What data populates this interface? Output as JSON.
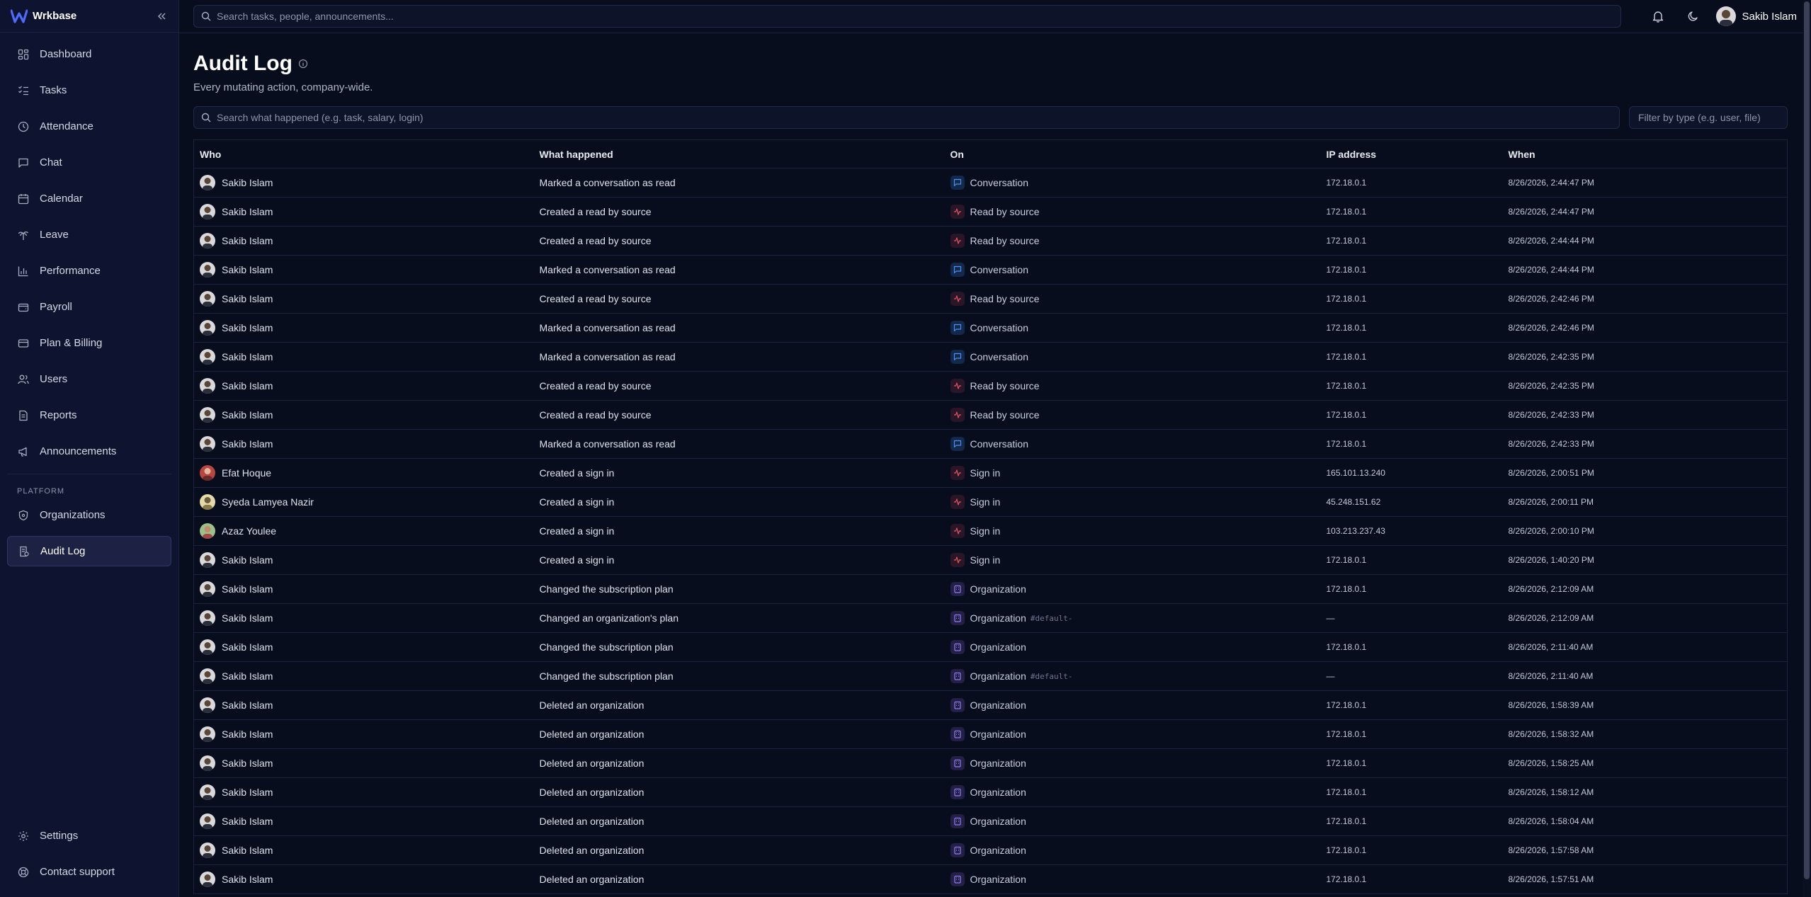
{
  "app": {
    "name": "Wrkbase"
  },
  "sidebar": {
    "items": [
      {
        "label": "Dashboard",
        "icon": "dashboard-icon"
      },
      {
        "label": "Tasks",
        "icon": "tasks-icon"
      },
      {
        "label": "Attendance",
        "icon": "clock-icon"
      },
      {
        "label": "Chat",
        "icon": "chat-icon"
      },
      {
        "label": "Calendar",
        "icon": "calendar-icon"
      },
      {
        "label": "Leave",
        "icon": "palm-tree-icon"
      },
      {
        "label": "Performance",
        "icon": "bar-chart-icon"
      },
      {
        "label": "Payroll",
        "icon": "wallet-icon"
      },
      {
        "label": "Plan & Billing",
        "icon": "credit-card-icon"
      },
      {
        "label": "Users",
        "icon": "users-icon"
      },
      {
        "label": "Reports",
        "icon": "file-icon"
      },
      {
        "label": "Announcements",
        "icon": "megaphone-icon"
      }
    ],
    "platform_label": "PLATFORM",
    "platform_items": [
      {
        "label": "Organizations",
        "icon": "shield-icon"
      },
      {
        "label": "Audit Log",
        "icon": "audit-log-icon",
        "active": true
      }
    ],
    "bottom_items": [
      {
        "label": "Settings",
        "icon": "gear-icon"
      },
      {
        "label": "Contact support",
        "icon": "lifebuoy-icon"
      }
    ]
  },
  "topbar": {
    "search_placeholder": "Search tasks, people, announcements...",
    "user_name": "Sakib Islam"
  },
  "page": {
    "title": "Audit Log",
    "subtitle": "Every mutating action, company-wide.",
    "search_placeholder": "Search what happened (e.g. task, salary, login)",
    "type_filter_placeholder": "Filter by type (e.g. user, file)"
  },
  "table": {
    "columns": [
      "Who",
      "What happened",
      "On",
      "IP address",
      "When"
    ],
    "rows": [
      {
        "who": "Sakib Islam",
        "avatar": "sakib",
        "what": "Marked a conversation as read",
        "on": "Conversation",
        "on_type": "conv",
        "ref": "",
        "ip": "172.18.0.1",
        "when": "8/26/2026, 2:44:47 PM"
      },
      {
        "who": "Sakib Islam",
        "avatar": "sakib",
        "what": "Created a read by source",
        "on": "Read by source",
        "on_type": "read",
        "ref": "",
        "ip": "172.18.0.1",
        "when": "8/26/2026, 2:44:47 PM"
      },
      {
        "who": "Sakib Islam",
        "avatar": "sakib",
        "what": "Created a read by source",
        "on": "Read by source",
        "on_type": "read",
        "ref": "",
        "ip": "172.18.0.1",
        "when": "8/26/2026, 2:44:44 PM"
      },
      {
        "who": "Sakib Islam",
        "avatar": "sakib",
        "what": "Marked a conversation as read",
        "on": "Conversation",
        "on_type": "conv",
        "ref": "",
        "ip": "172.18.0.1",
        "when": "8/26/2026, 2:44:44 PM"
      },
      {
        "who": "Sakib Islam",
        "avatar": "sakib",
        "what": "Created a read by source",
        "on": "Read by source",
        "on_type": "read",
        "ref": "",
        "ip": "172.18.0.1",
        "when": "8/26/2026, 2:42:46 PM"
      },
      {
        "who": "Sakib Islam",
        "avatar": "sakib",
        "what": "Marked a conversation as read",
        "on": "Conversation",
        "on_type": "conv",
        "ref": "",
        "ip": "172.18.0.1",
        "when": "8/26/2026, 2:42:46 PM"
      },
      {
        "who": "Sakib Islam",
        "avatar": "sakib",
        "what": "Marked a conversation as read",
        "on": "Conversation",
        "on_type": "conv",
        "ref": "",
        "ip": "172.18.0.1",
        "when": "8/26/2026, 2:42:35 PM"
      },
      {
        "who": "Sakib Islam",
        "avatar": "sakib",
        "what": "Created a read by source",
        "on": "Read by source",
        "on_type": "read",
        "ref": "",
        "ip": "172.18.0.1",
        "when": "8/26/2026, 2:42:35 PM"
      },
      {
        "who": "Sakib Islam",
        "avatar": "sakib",
        "what": "Created a read by source",
        "on": "Read by source",
        "on_type": "read",
        "ref": "",
        "ip": "172.18.0.1",
        "when": "8/26/2026, 2:42:33 PM"
      },
      {
        "who": "Sakib Islam",
        "avatar": "sakib",
        "what": "Marked a conversation as read",
        "on": "Conversation",
        "on_type": "conv",
        "ref": "",
        "ip": "172.18.0.1",
        "when": "8/26/2026, 2:42:33 PM"
      },
      {
        "who": "Efat Hoque",
        "avatar": "efat",
        "what": "Created a sign in",
        "on": "Sign in",
        "on_type": "sign",
        "ref": "",
        "ip": "165.101.13.240",
        "when": "8/26/2026, 2:00:51 PM"
      },
      {
        "who": "Syeda Lamyea Nazir",
        "avatar": "syeda",
        "what": "Created a sign in",
        "on": "Sign in",
        "on_type": "sign",
        "ref": "",
        "ip": "45.248.151.62",
        "when": "8/26/2026, 2:00:11 PM"
      },
      {
        "who": "Azaz Youlee",
        "avatar": "azaz",
        "what": "Created a sign in",
        "on": "Sign in",
        "on_type": "sign",
        "ref": "",
        "ip": "103.213.237.43",
        "when": "8/26/2026, 2:00:10 PM"
      },
      {
        "who": "Sakib Islam",
        "avatar": "sakib",
        "what": "Created a sign in",
        "on": "Sign in",
        "on_type": "sign",
        "ref": "",
        "ip": "172.18.0.1",
        "when": "8/26/2026, 1:40:20 PM"
      },
      {
        "who": "Sakib Islam",
        "avatar": "sakib",
        "what": "Changed the subscription plan",
        "on": "Organization",
        "on_type": "org",
        "ref": "",
        "ip": "172.18.0.1",
        "when": "8/26/2026, 2:12:09 AM"
      },
      {
        "who": "Sakib Islam",
        "avatar": "sakib",
        "what": "Changed an organization's plan",
        "on": "Organization",
        "on_type": "org",
        "ref": "#default-",
        "ip": "—",
        "when": "8/26/2026, 2:12:09 AM"
      },
      {
        "who": "Sakib Islam",
        "avatar": "sakib",
        "what": "Changed the subscription plan",
        "on": "Organization",
        "on_type": "org",
        "ref": "",
        "ip": "172.18.0.1",
        "when": "8/26/2026, 2:11:40 AM"
      },
      {
        "who": "Sakib Islam",
        "avatar": "sakib",
        "what": "Changed the subscription plan",
        "on": "Organization",
        "on_type": "org",
        "ref": "#default-",
        "ip": "—",
        "when": "8/26/2026, 2:11:40 AM"
      },
      {
        "who": "Sakib Islam",
        "avatar": "sakib",
        "what": "Deleted an organization",
        "on": "Organization",
        "on_type": "org",
        "ref": "",
        "ip": "172.18.0.1",
        "when": "8/26/2026, 1:58:39 AM"
      },
      {
        "who": "Sakib Islam",
        "avatar": "sakib",
        "what": "Deleted an organization",
        "on": "Organization",
        "on_type": "org",
        "ref": "",
        "ip": "172.18.0.1",
        "when": "8/26/2026, 1:58:32 AM"
      },
      {
        "who": "Sakib Islam",
        "avatar": "sakib",
        "what": "Deleted an organization",
        "on": "Organization",
        "on_type": "org",
        "ref": "",
        "ip": "172.18.0.1",
        "when": "8/26/2026, 1:58:25 AM"
      },
      {
        "who": "Sakib Islam",
        "avatar": "sakib",
        "what": "Deleted an organization",
        "on": "Organization",
        "on_type": "org",
        "ref": "",
        "ip": "172.18.0.1",
        "when": "8/26/2026, 1:58:12 AM"
      },
      {
        "who": "Sakib Islam",
        "avatar": "sakib",
        "what": "Deleted an organization",
        "on": "Organization",
        "on_type": "org",
        "ref": "",
        "ip": "172.18.0.1",
        "when": "8/26/2026, 1:58:04 AM"
      },
      {
        "who": "Sakib Islam",
        "avatar": "sakib",
        "what": "Deleted an organization",
        "on": "Organization",
        "on_type": "org",
        "ref": "",
        "ip": "172.18.0.1",
        "when": "8/26/2026, 1:57:58 AM"
      },
      {
        "who": "Sakib Islam",
        "avatar": "sakib",
        "what": "Deleted an organization",
        "on": "Organization",
        "on_type": "org",
        "ref": "",
        "ip": "172.18.0.1",
        "when": "8/26/2026, 1:57:51 AM"
      }
    ]
  },
  "colors": {
    "background": "#080d1d",
    "sidebar": "#0e1430",
    "accent": "#4f46e5",
    "conversation": "#4a90f0",
    "read_by_source": "#e05563",
    "organization": "#8c7ef0"
  }
}
